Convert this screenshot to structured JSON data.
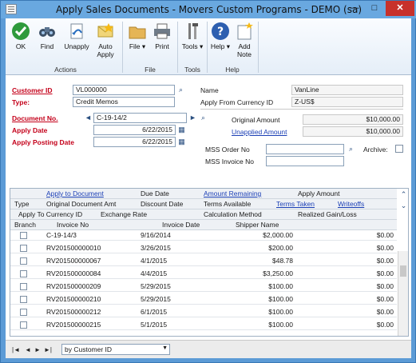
{
  "window": {
    "title": "Apply Sales Documents - Movers Custom Programs  -  DEMO (sa)",
    "minimize": "—",
    "maximize": "□",
    "close": "✕"
  },
  "ribbon": {
    "actions": [
      {
        "label": "OK",
        "icon": "ok-check-icon"
      },
      {
        "label": "Find",
        "icon": "binoculars-icon"
      },
      {
        "label": "Unapply",
        "icon": "unapply-icon"
      },
      {
        "label": "Auto Apply",
        "line1": "Auto",
        "line2": "Apply",
        "icon": "auto-apply-envelope-icon"
      }
    ],
    "file": [
      {
        "label": "File",
        "icon": "folder-icon",
        "arrow": "▾"
      },
      {
        "label": "Print",
        "icon": "printer-icon"
      }
    ],
    "tools": [
      {
        "label": "Tools",
        "icon": "tools-icon",
        "arrow": "▾"
      }
    ],
    "help": [
      {
        "label": "Help",
        "icon": "help-icon",
        "arrow": "▾"
      },
      {
        "label": "Add Note",
        "line1": "Add",
        "line2": "Note",
        "icon": "add-note-icon"
      }
    ],
    "groups": {
      "actions": "Actions",
      "file": "File",
      "tools": "Tools",
      "help": "Help"
    }
  },
  "form": {
    "customer_id_label": "Customer ID",
    "customer_id": "VL000000",
    "type_label": "Type:",
    "type_value": "Credit Memos",
    "document_no_label": "Document No.",
    "document_no": "C-19-14/2",
    "apply_date_label": "Apply Date",
    "apply_date": "6/22/2015",
    "apply_posting_date_label": "Apply Posting Date",
    "apply_posting_date": "6/22/2015",
    "name_label": "Name",
    "name": "VanLine",
    "apply_from_currency_label": "Apply From Currency ID",
    "apply_from_currency": "Z-US$",
    "original_amount_label": "Original Amount",
    "original_amount": "$10,000.00",
    "unapplied_amount_label": "Unapplied Amount",
    "unapplied_amount": "$10,000.00",
    "mss_order_label": "MSS Order No",
    "mss_order": "",
    "archive_label": "Archive:",
    "mss_invoice_label": "MSS Invoice No",
    "mss_invoice": ""
  },
  "grid": {
    "header1": [
      "Apply to Document",
      "Due Date",
      "Amount Remaining",
      "Apply Amount"
    ],
    "header2": [
      "Type",
      "Original Document Amt",
      "Discount Date",
      "Terms Available",
      "Terms Taken",
      "Writeoffs"
    ],
    "header3": [
      "Apply To Currency ID",
      "Exchange Rate",
      "Calculation Method",
      "Realized Gain/Loss"
    ],
    "header4": [
      "Branch",
      "Invoice No",
      "Invoice Date",
      "Shipper Name"
    ],
    "rows": [
      {
        "doc": "C-19-14/3",
        "date": "9/16/2014",
        "amount": "$2,000.00",
        "apply": "$0.00"
      },
      {
        "doc": "RV201500000010",
        "date": "3/26/2015",
        "amount": "$200.00",
        "apply": "$0.00"
      },
      {
        "doc": "RV201500000067",
        "date": "4/1/2015",
        "amount": "$48.78",
        "apply": "$0.00"
      },
      {
        "doc": "RV201500000084",
        "date": "4/4/2015",
        "amount": "$3,250.00",
        "apply": "$0.00"
      },
      {
        "doc": "RV201500000209",
        "date": "5/29/2015",
        "amount": "$100.00",
        "apply": "$0.00"
      },
      {
        "doc": "RV201500000210",
        "date": "5/29/2015",
        "amount": "$100.00",
        "apply": "$0.00"
      },
      {
        "doc": "RV201500000212",
        "date": "6/1/2015",
        "amount": "$100.00",
        "apply": "$0.00"
      },
      {
        "doc": "RV201500000215",
        "date": "5/1/2015",
        "amount": "$100.00",
        "apply": "$0.00"
      }
    ]
  },
  "status": {
    "nav_first": "|◄",
    "nav_prev": "◄",
    "nav_next": "►",
    "nav_last": "►|",
    "sort_by": "by Customer ID",
    "dropdown_arrow": "▼"
  },
  "colors": {
    "required": "#c4001a",
    "link": "#1b3fb5",
    "title_bar": "#69a8e0",
    "close": "#c7312b"
  },
  "icons": {
    "lookup": "⌕",
    "calendar": "▦",
    "nav_left": "◄",
    "nav_right": "►",
    "expand": "⌃",
    "collapse": "⌄"
  }
}
